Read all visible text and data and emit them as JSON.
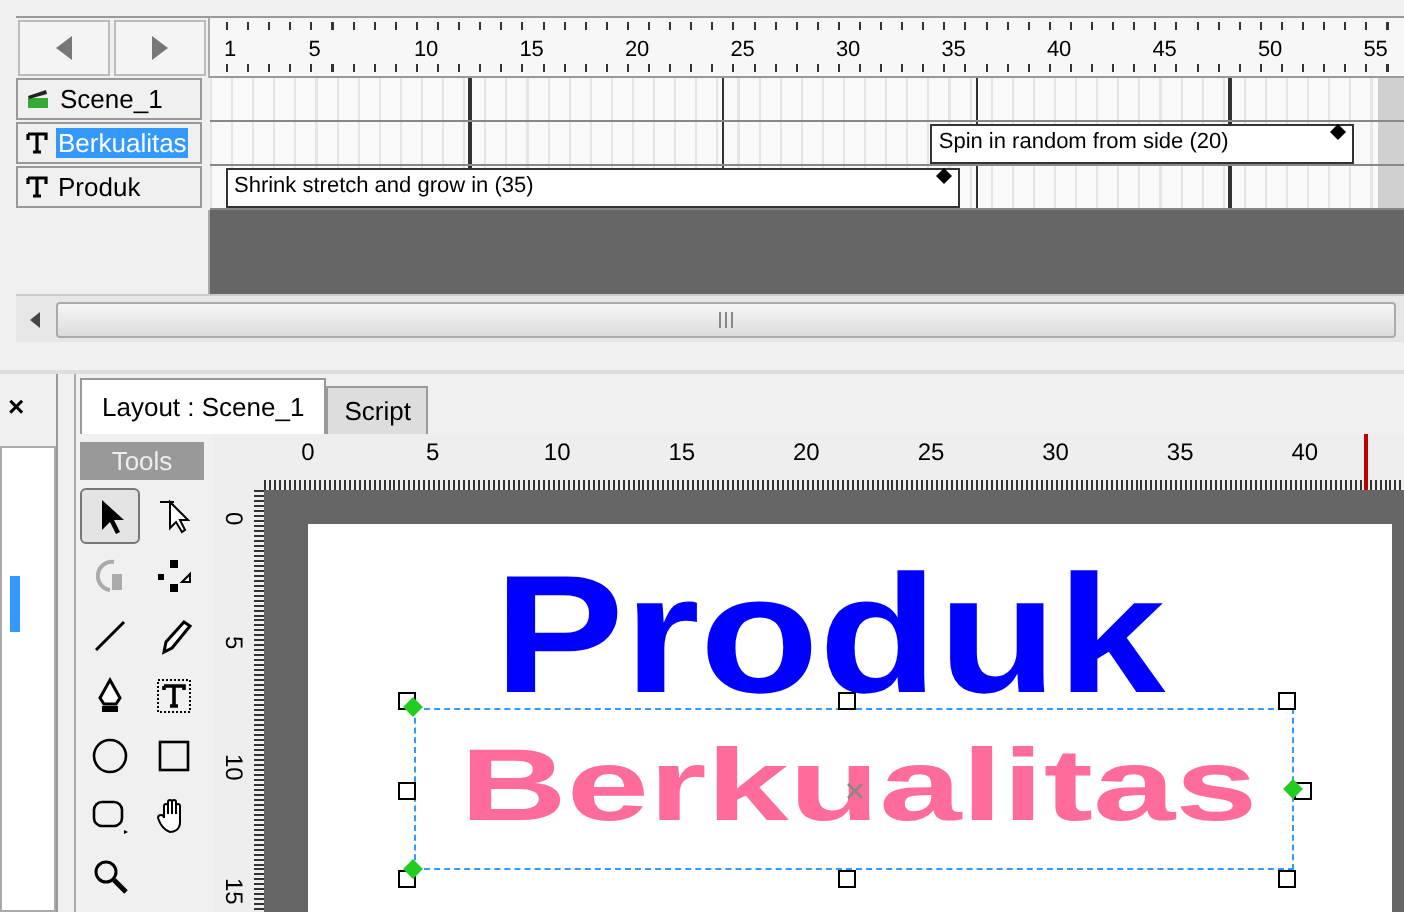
{
  "timeline": {
    "ruler_labels": [
      "1",
      "5",
      "10",
      "15",
      "20",
      "25",
      "30",
      "35",
      "40",
      "45",
      "50",
      "55"
    ],
    "layers": [
      {
        "name": "Scene_1",
        "kind": "scene",
        "selected": false
      },
      {
        "name": "Berkualitas",
        "kind": "text",
        "selected": true,
        "transition": "Spin in random from side (20)"
      },
      {
        "name": "Produk",
        "kind": "text",
        "selected": false,
        "transition": "Shrink stretch and grow in (35)"
      }
    ]
  },
  "layout": {
    "close": "×",
    "tabs": [
      {
        "label": "Layout : Scene_1",
        "selected": true
      },
      {
        "label": "Script",
        "selected": false
      }
    ],
    "tools_title": "Tools",
    "tools": [
      {
        "kind": "select",
        "selected": true
      },
      {
        "kind": "subselect",
        "selected": false
      },
      {
        "kind": "rotate",
        "selected": false,
        "disabled": true
      },
      {
        "kind": "reshape",
        "selected": false
      },
      {
        "kind": "line",
        "selected": false
      },
      {
        "kind": "pencil",
        "selected": false
      },
      {
        "kind": "pen",
        "selected": false
      },
      {
        "kind": "text",
        "selected": false
      },
      {
        "kind": "ellipse",
        "selected": false
      },
      {
        "kind": "rectangle",
        "selected": false
      },
      {
        "kind": "rounded",
        "selected": false
      },
      {
        "kind": "hand",
        "selected": false
      },
      {
        "kind": "zoom",
        "selected": false
      }
    ],
    "h_ruler": [
      "0",
      "5",
      "10",
      "15",
      "20",
      "25",
      "30",
      "35",
      "40"
    ],
    "v_ruler": [
      "0",
      "5",
      "10",
      "15"
    ],
    "stage": [
      {
        "kind": "title",
        "text": "Produk",
        "color": "#0000ff"
      },
      {
        "kind": "subtitle",
        "text": "Berkualitas",
        "color": "#ff6b9a",
        "selected": true
      }
    ]
  }
}
